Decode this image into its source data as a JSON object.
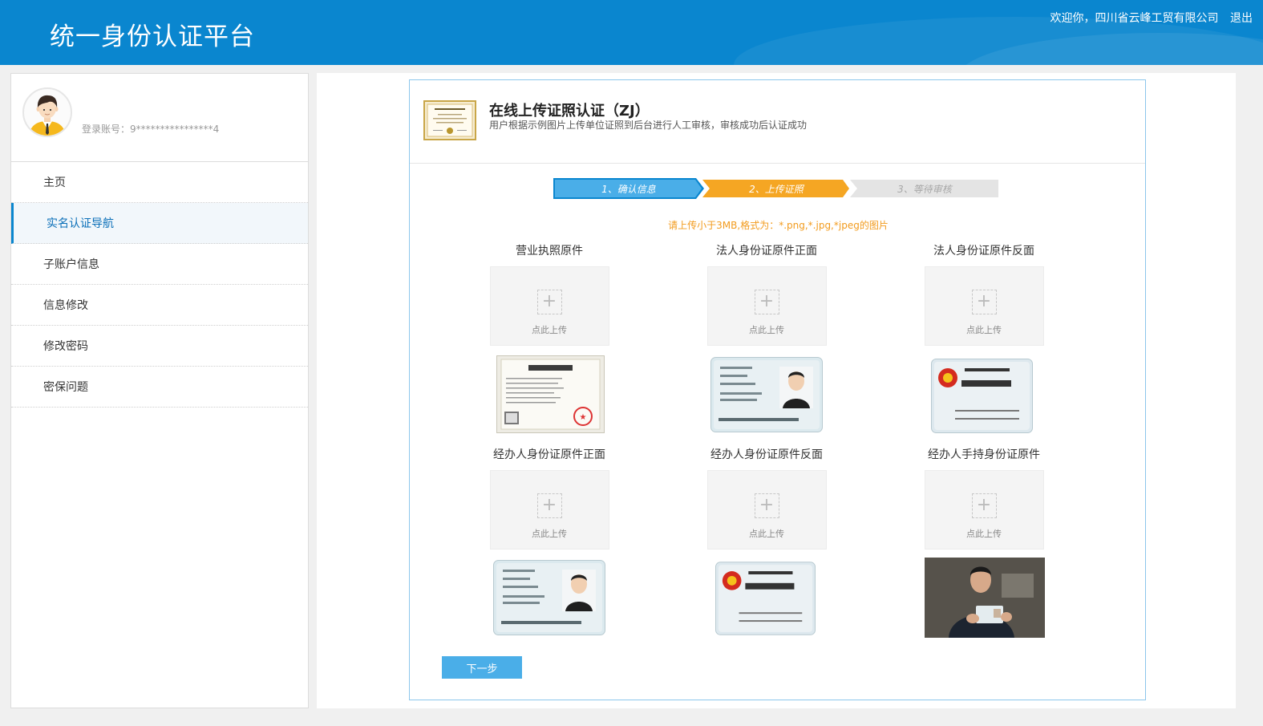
{
  "header": {
    "title": "统一身份认证平台",
    "welcome": "欢迎你，四川省云峰工贸有限公司",
    "logout": "退出",
    "bg_color": "#0a86cf"
  },
  "sidebar": {
    "account": "登录账号：9****************4",
    "items": [
      {
        "label": "主页"
      },
      {
        "label": "实名认证导航"
      },
      {
        "label": "子账户信息"
      },
      {
        "label": "信息修改"
      },
      {
        "label": "修改密码"
      },
      {
        "label": "密保问题"
      }
    ]
  },
  "panel": {
    "title": "在线上传证照认证（ZJ）",
    "desc": "用户根据示例图片上传单位证照到后台进行人工审核，审核成功后认证成功",
    "steps": [
      {
        "label": "1、确认信息",
        "color": "#4aaee8"
      },
      {
        "label": "2、上传证照",
        "color": "#f5a623"
      },
      {
        "label": "3、等待审核",
        "color": "#e4e4e4"
      }
    ],
    "hint": "请上传小于3MB,格式为：*.png,*.jpg,*jpeg的图片",
    "upload_text": "点此上传",
    "uploads": [
      {
        "title": "营业执照原件",
        "sample_icon": "business-license-icon"
      },
      {
        "title": "法人身份证原件正面",
        "sample_icon": "id-card-front-icon"
      },
      {
        "title": "法人身份证原件反面",
        "sample_icon": "id-card-back-icon"
      },
      {
        "title": "经办人身份证原件正面",
        "sample_icon": "id-card-front-icon"
      },
      {
        "title": "经办人身份证原件反面",
        "sample_icon": "id-card-back-icon"
      },
      {
        "title": "经办人手持身份证原件",
        "sample_icon": "hand-held-id-photo-icon"
      }
    ],
    "next_button": "下一步",
    "accent_color": "#4aaee8"
  }
}
